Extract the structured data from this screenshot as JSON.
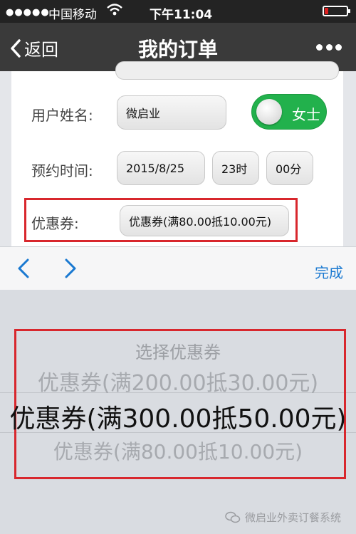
{
  "status_bar": {
    "signal": "●●●●●",
    "carrier": "中国移动",
    "time": "下午11:04",
    "battery_level": 0.15,
    "battery_color": "#e02020"
  },
  "nav": {
    "back_label": "返回",
    "title": "我的订单"
  },
  "form": {
    "name_label": "用户姓名:",
    "name_value": "微启业",
    "gender_label": "女士",
    "gender_toggle_on": true,
    "time_label": "预约时间:",
    "date_value": "2015/8/25",
    "hour_value": "23时",
    "minute_value": "00分",
    "coupon_label": "优惠券:",
    "coupon_value": "优惠券(满80.00抵10.00元)"
  },
  "toolbar": {
    "done_label": "完成"
  },
  "picker": {
    "title": "选择优惠券",
    "options": [
      "优惠券(满200.00抵30.00元)",
      "优惠券(满300.00抵50.00元)",
      "优惠券(满80.00抵10.00元)"
    ],
    "selected_index": 1
  },
  "watermark": {
    "text": "微启业外卖订餐系统"
  },
  "colors": {
    "accent": "#1a79d1",
    "toggle_green": "#22b14c",
    "highlight_red": "#d8272d",
    "nav_bg": "#3a3a3a"
  }
}
